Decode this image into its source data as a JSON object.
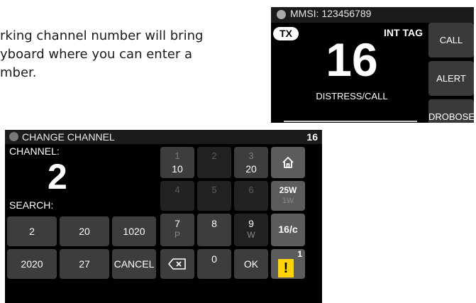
{
  "help_text": {
    "line1": "rking channel number will bring",
    "line2": "yboard where you can enter a",
    "line3": "mber."
  },
  "top_radio": {
    "status_text": "MMSI: 123456789",
    "tx_badge": "TX",
    "mode_label": "INT TAG",
    "channel_number": "16",
    "channel_name": "DISTRESS/CALL",
    "buttons": [
      {
        "label": "CALL"
      },
      {
        "label": "ALERT"
      },
      {
        "label": "DROBOSE"
      }
    ]
  },
  "change_channel": {
    "title": "CHANGE CHANNEL",
    "current_channel": "16",
    "channel_label": "CHANNEL:",
    "channel_value": "2",
    "search_label": "SEARCH:",
    "search_results": [
      "2",
      "20",
      "1020",
      "2020",
      "27"
    ],
    "cancel_label": "CANCEL",
    "ok_label": "OK",
    "keypad": {
      "k1": {
        "top": "1",
        "bottom": "10"
      },
      "k2": {
        "top": "2",
        "bottom": ""
      },
      "k3": {
        "top": "3",
        "bottom": "20"
      },
      "k4": {
        "top": "4",
        "bottom": ""
      },
      "k5": {
        "top": "5",
        "bottom": ""
      },
      "k6": {
        "top": "6",
        "bottom": ""
      },
      "k7": {
        "top": "7",
        "bottom": "P"
      },
      "k8": {
        "top": "8",
        "bottom": ""
      },
      "k9": {
        "top": "9",
        "bottom": "W"
      },
      "k0": {
        "top": "0",
        "bottom": ""
      }
    },
    "power": {
      "high": "25W",
      "low": "1W"
    },
    "dual_watch_label": "16/c",
    "alert_badge": "!",
    "alert_count": "1"
  }
}
